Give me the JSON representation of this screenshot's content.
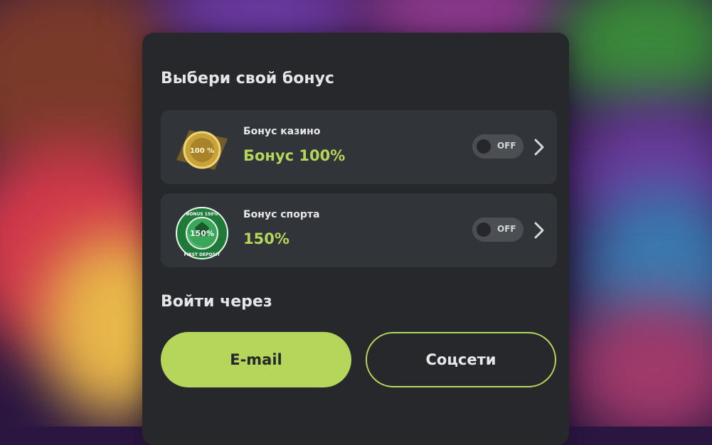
{
  "modal": {
    "bonus_title": "Выбери свой бонус",
    "login_title": "Войти через"
  },
  "bonuses": [
    {
      "subtitle": "Бонус казино",
      "value": "Бонус 100%",
      "toggle": "OFF",
      "badge_text": "100 %",
      "badge_icon": "gold-coin-badge-icon"
    },
    {
      "subtitle": "Бонус спорта",
      "value": "150%",
      "toggle": "OFF",
      "badge_text": "150%",
      "badge_ring_top": "BONUS 150%",
      "badge_ring_bottom": "FIRST DEPOSIT",
      "badge_icon": "football-badge-icon"
    }
  ],
  "login": {
    "email_label": "E-mail",
    "social_label": "Соцсети"
  },
  "colors": {
    "accent": "#b5d65a",
    "modal_bg": "#26282c",
    "card_bg": "#313438",
    "toggle_bg": "#4b4e53"
  }
}
